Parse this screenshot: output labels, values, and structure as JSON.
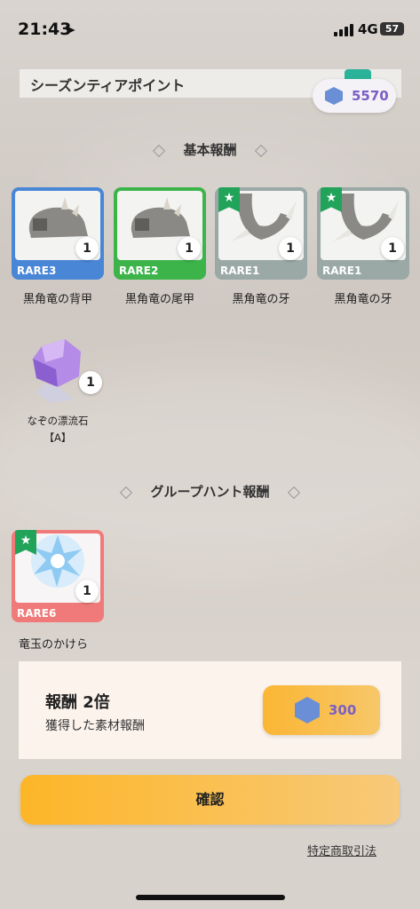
{
  "status_bar": {
    "time": "21:43",
    "network": "4G",
    "battery": "57"
  },
  "season": {
    "label": "シーズンティアポイント",
    "points": "5570"
  },
  "sections": {
    "basic": "基本報酬",
    "group": "グループハント報酬"
  },
  "basic_items": [
    {
      "name": "黒角竜の背甲",
      "rarity": "RARE3",
      "qty": "1",
      "color": "#4a86d6",
      "starred": false
    },
    {
      "name": "黒角竜の尾甲",
      "rarity": "RARE2",
      "qty": "1",
      "color": "#3cb44a",
      "starred": false
    },
    {
      "name": "黒角竜の牙",
      "rarity": "RARE1",
      "qty": "1",
      "color": "#9aa9a6",
      "starred": true
    },
    {
      "name": "黒角竜の牙",
      "rarity": "RARE1",
      "qty": "1",
      "color": "#9aa9a6",
      "starred": true
    }
  ],
  "extra_item": {
    "name_line1": "なぞの漂流石",
    "name_line2": "【A】",
    "qty": "1"
  },
  "group_item": {
    "name": "竜玉のかけら",
    "rarity": "RARE6",
    "qty": "1",
    "color": "#f07a7a",
    "starred": true
  },
  "reward_box": {
    "title": "報酬 2倍",
    "subtitle": "獲得した素材報酬",
    "cost": "300"
  },
  "confirm_label": "確認",
  "legal_link": "特定商取引法"
}
